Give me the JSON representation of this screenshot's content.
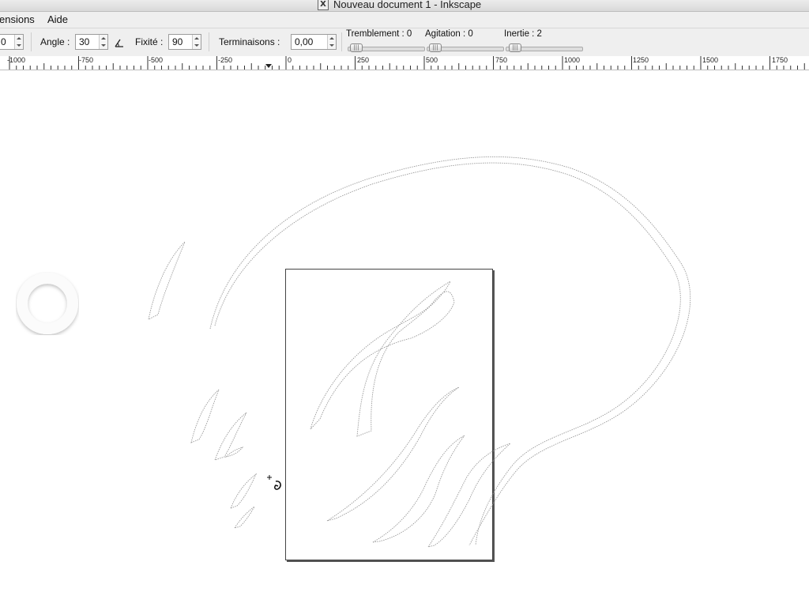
{
  "window": {
    "title": "Nouveau document 1 - Inkscape"
  },
  "menu": {
    "items": [
      "ensions",
      "Aide"
    ]
  },
  "toolbar": {
    "width_value": "0",
    "angle_label": "Angle :",
    "angle_value": "30",
    "fixation_label": "Fixité :",
    "fixation_value": "90",
    "caps_label": "Terminaisons :",
    "caps_value": "0,00",
    "tremor_label": "Tremblement : 0",
    "wiggle_label": "Agitation : 0",
    "mass_label": "Inertie : 2",
    "sliders": {
      "tremor": 0,
      "wiggle": 0,
      "mass": 2
    }
  },
  "ruler": {
    "labels": [
      "-1000",
      "-750",
      "-500",
      "-250",
      "0",
      "250",
      "500",
      "750",
      "1000",
      "1250",
      "1500",
      "1750"
    ]
  },
  "icons": [
    "x11-icon",
    "use-pressure-icon",
    "calligraphy-cursor-icon",
    "busy-ring-icon"
  ],
  "colors": {
    "stroke_outline": "#9a9a9a",
    "page_border": "#444444",
    "chrome": "#efefef"
  }
}
